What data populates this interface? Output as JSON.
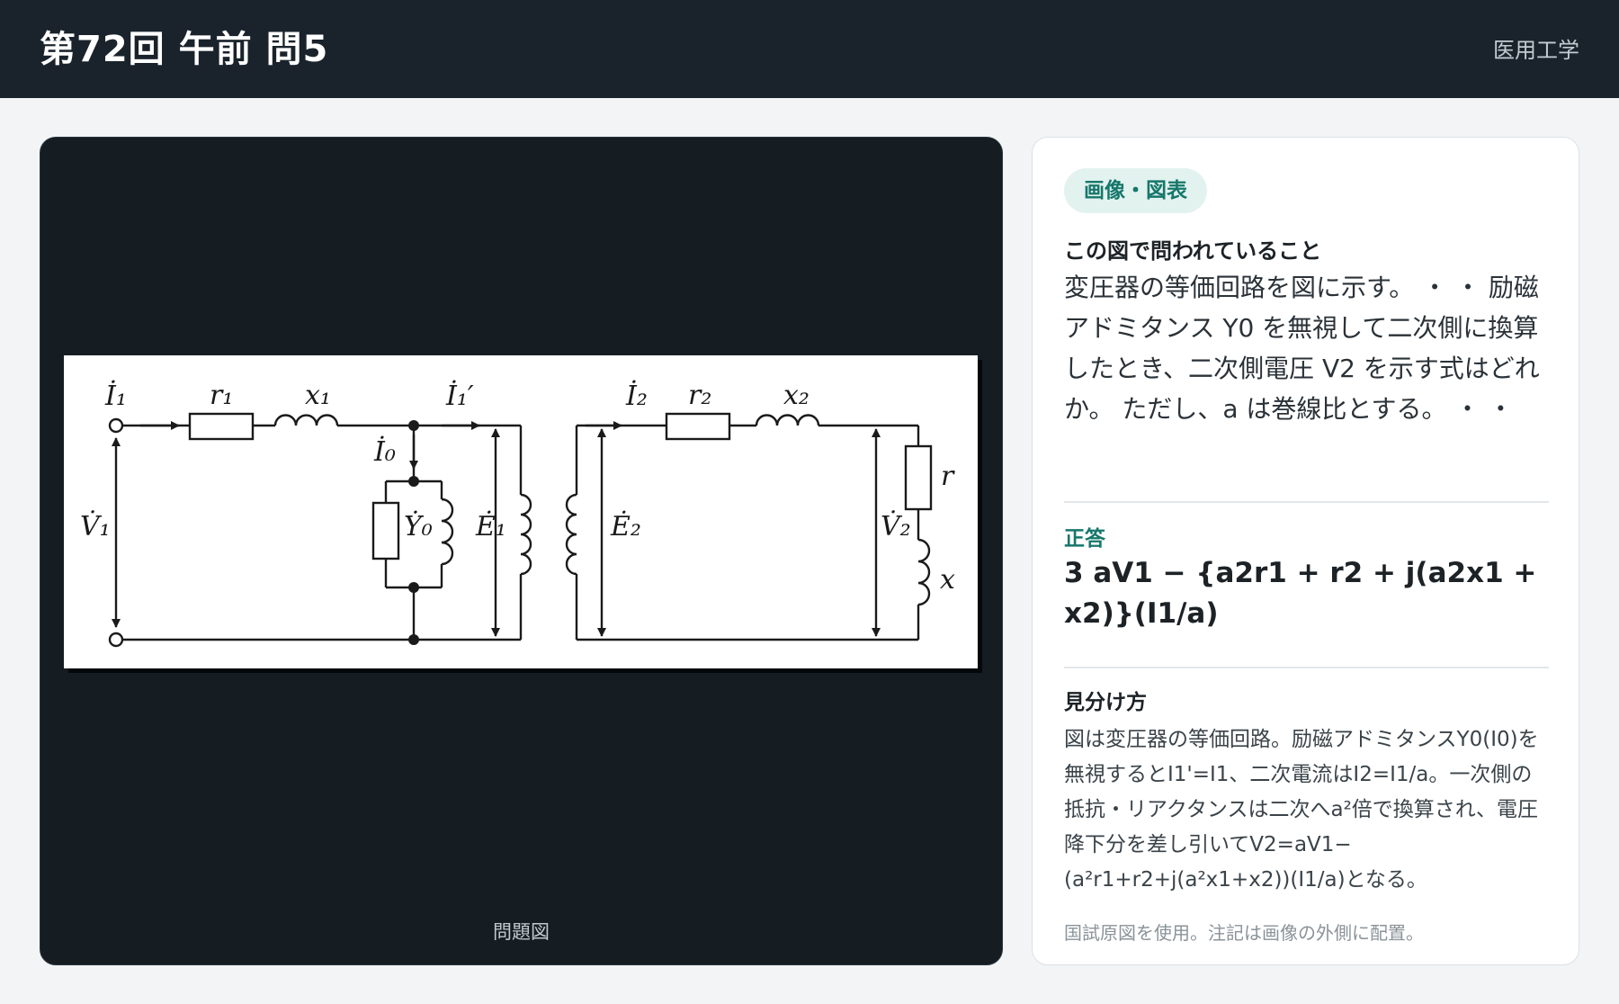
{
  "header": {
    "title": "第72回 午前 問5",
    "subject": "医用工学"
  },
  "figure": {
    "caption": "問題図",
    "labels": {
      "I1": "İ₁",
      "r1": "r₁",
      "x1": "x₁",
      "I1p": "İ₁′",
      "I0": "İ₀",
      "V1": "V̇₁",
      "Y0": "Ẏ₀",
      "E1": "Ė₁",
      "E2": "Ė₂",
      "I2": "İ₂",
      "r2": "r₂",
      "x2": "x₂",
      "r": "r",
      "V2": "V̇₂",
      "x": "x"
    }
  },
  "info": {
    "tag": "画像・図表",
    "question_label": "この図で問われていること",
    "question_text": "変圧器の等価回路を図に示す。 ・ ・ 励磁アドミタンス Y0 を無視して二次側に換算したとき、二次側電圧 V2 を示す式はどれか。 ただし、a は巻線比とする。 ・ ・",
    "answer_label": "正答",
    "answer_text": "3 aV1 − {a2r1 + r2 + j(a2x1 + x2)}(I1/a)",
    "hint_label": "見分け方",
    "hint_text": "図は変圧器の等価回路。励磁アドミタンスY0(I0)を無視するとI1'=I1、二次電流はI2=I1/a。一次側の抵抗・リアクタンスは二次へa²倍で換算され、電圧降下分を差し引いてV2=aV1−(a²r1+r2+j(a²x1+x2))(I1/a)となる。",
    "footnote": "国試原図を使用。注記は画像の外側に配置。"
  }
}
